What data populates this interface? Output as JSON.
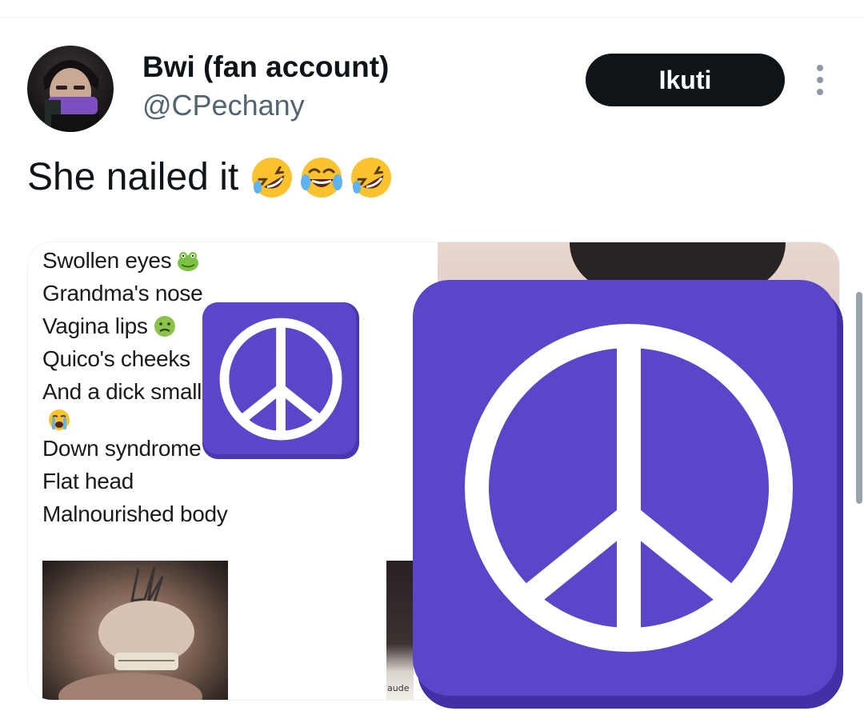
{
  "post": {
    "display_name": "Bwi (fan account)",
    "handle": "@CPechany",
    "follow_label": "Ikuti",
    "text": "She nailed it",
    "text_emojis": [
      "rolling-on-floor-laughing",
      "face-with-tears-of-joy",
      "rolling-on-floor-laughing"
    ]
  },
  "media": {
    "caption_lines": [
      {
        "text": "Swollen eyes",
        "emoji": "frog"
      },
      {
        "text": "Grandma's nose",
        "emoji": ""
      },
      {
        "text": "Vagina lips",
        "emoji": "nauseated-face"
      },
      {
        "text": "Quico's cheeks",
        "emoji": ""
      },
      {
        "text": "And a dick smaller than a clitoris",
        "emoji": ""
      },
      {
        "text": "",
        "emoji": "loudly-crying-face"
      },
      {
        "text": "Down syndrome face",
        "emoji": ""
      },
      {
        "text": "Flat head",
        "emoji": ""
      },
      {
        "text": "Malnourished body",
        "emoji": ""
      }
    ],
    "thumb_label": "aude",
    "sticker_icon": "peace-sign-icon"
  },
  "colors": {
    "follow_bg": "#0f1419",
    "handle": "#536471",
    "sticker_purple": "#5b45c9",
    "sticker_white": "#ffffff"
  }
}
